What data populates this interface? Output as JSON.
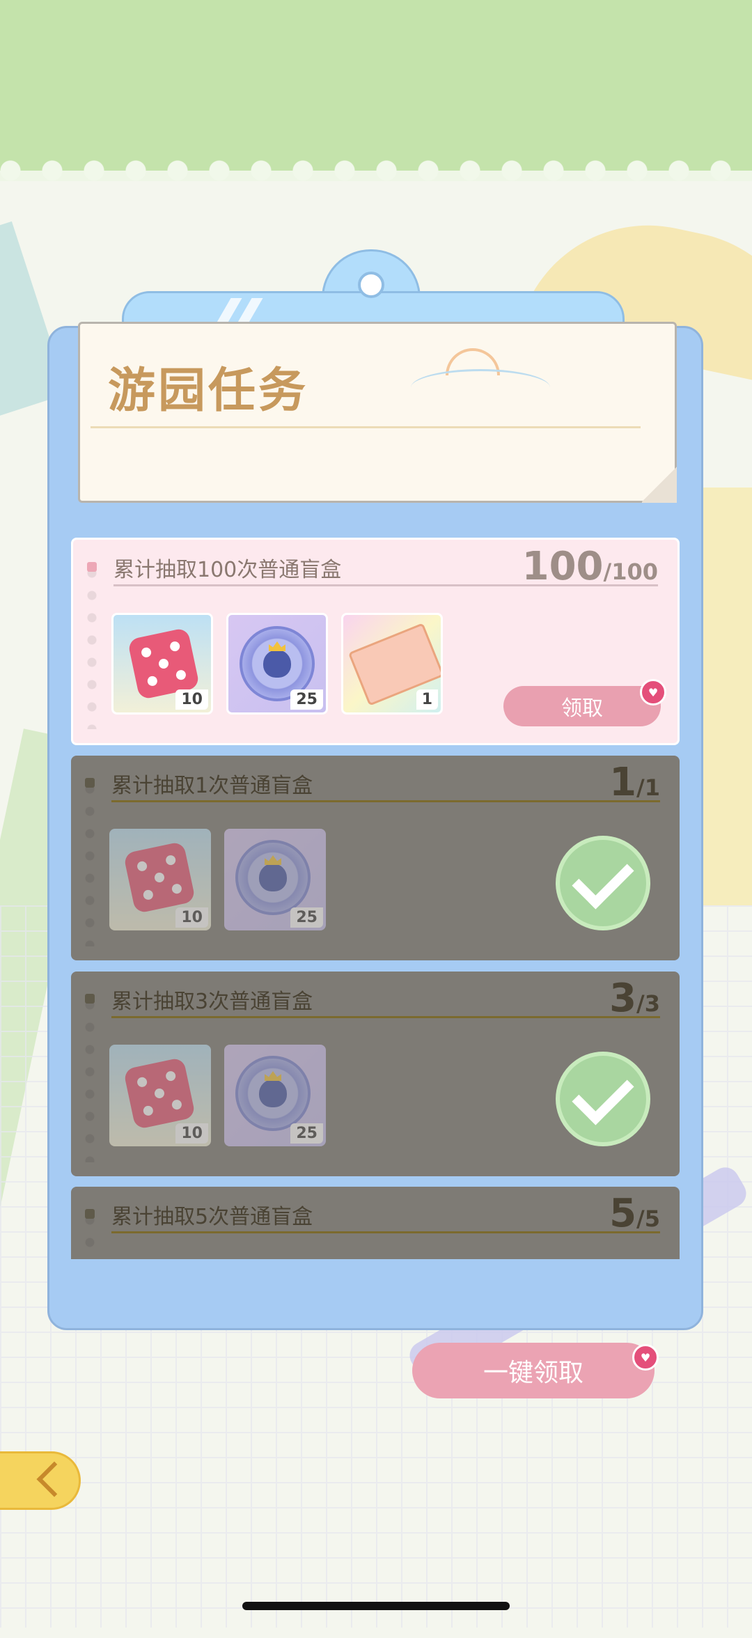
{
  "title": "游园任务",
  "tasks": [
    {
      "label": "累计抽取100次普通盲盒",
      "progress_current": "100",
      "progress_max": "/100",
      "state": "claimable",
      "claim_label": "领取",
      "rewards": [
        {
          "type": "dice",
          "count": "10"
        },
        {
          "type": "penguin-coin",
          "count": "25"
        },
        {
          "type": "ticket",
          "count": "1"
        }
      ]
    },
    {
      "label": "累计抽取1次普通盲盒",
      "progress_current": "1",
      "progress_max": "/1",
      "state": "claimed",
      "rewards": [
        {
          "type": "dice",
          "count": "10"
        },
        {
          "type": "penguin-coin",
          "count": "25"
        }
      ]
    },
    {
      "label": "累计抽取3次普通盲盒",
      "progress_current": "3",
      "progress_max": "/3",
      "state": "claimed",
      "rewards": [
        {
          "type": "dice",
          "count": "10"
        },
        {
          "type": "penguin-coin",
          "count": "25"
        }
      ]
    },
    {
      "label": "累计抽取5次普通盲盒",
      "progress_current": "5",
      "progress_max": "/5",
      "state": "claimed"
    }
  ],
  "claim_all_label": "一键领取",
  "icons": {
    "badge": "heart-icon",
    "back": "back-arrow-icon",
    "done": "checkmark-icon"
  },
  "colors": {
    "claim_button": "#e9a0b0",
    "board": "#a6cbf3",
    "done_overlay": "#7e7b75",
    "check": "#a9d6a0"
  }
}
